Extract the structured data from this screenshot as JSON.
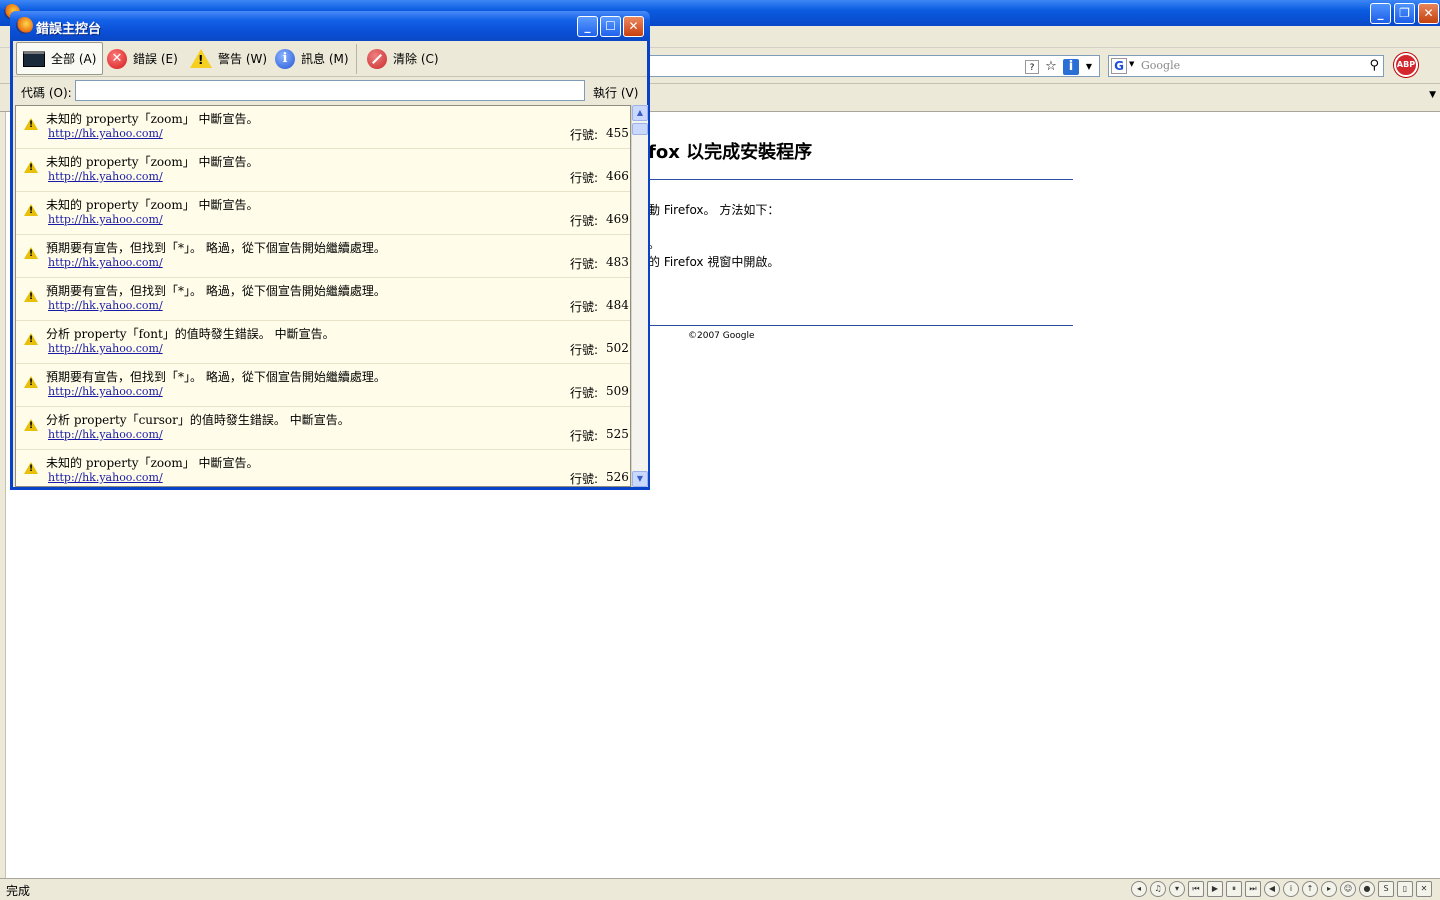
{
  "browser": {
    "search_placeholder": "Google",
    "abp_label": "ABP",
    "status_text": "完成"
  },
  "page": {
    "heading": "fox 以完成安裝程序",
    "line1": "動 Firefox。 方法如下：",
    "line2": "。",
    "line3": "的 Firefox 視窗中開啟。",
    "copyright": "©2007 Google"
  },
  "console": {
    "title": "錯誤主控台",
    "toolbar": [
      {
        "label": "全部 (A)",
        "icon": "all-icon"
      },
      {
        "label": "錯誤 (E)",
        "icon": "error-icon"
      },
      {
        "label": "警告 (W)",
        "icon": "warning-icon"
      },
      {
        "label": "訊息 (M)",
        "icon": "info-icon"
      },
      {
        "label": "清除 (C)",
        "icon": "clear-icon"
      }
    ],
    "code_label": "代碼 (O):",
    "code_value": "",
    "execute_label": "執行 (V)",
    "line_label": "行號:",
    "rows": [
      {
        "message": "未知的 property「zoom」 中斷宣告。",
        "source": "http://hk.yahoo.com/",
        "line": "455"
      },
      {
        "message": "未知的 property「zoom」 中斷宣告。",
        "source": "http://hk.yahoo.com/",
        "line": "466"
      },
      {
        "message": "未知的 property「zoom」 中斷宣告。",
        "source": "http://hk.yahoo.com/",
        "line": "469"
      },
      {
        "message": "預期要有宣告，但找到「*」。 略過，從下個宣告開始繼續處理。",
        "source": "http://hk.yahoo.com/",
        "line": "483"
      },
      {
        "message": "預期要有宣告，但找到「*」。 略過，從下個宣告開始繼續處理。",
        "source": "http://hk.yahoo.com/",
        "line": "484"
      },
      {
        "message": "分析 property「font」的值時發生錯誤。 中斷宣告。",
        "source": "http://hk.yahoo.com/",
        "line": "502"
      },
      {
        "message": "預期要有宣告，但找到「*」。 略過，從下個宣告開始繼續處理。",
        "source": "http://hk.yahoo.com/",
        "line": "509"
      },
      {
        "message": "分析 property「cursor」的值時發生錯誤。 中斷宣告。",
        "source": "http://hk.yahoo.com/",
        "line": "525"
      },
      {
        "message": "未知的 property「zoom」 中斷宣告。",
        "source": "http://hk.yahoo.com/",
        "line": "526"
      }
    ]
  }
}
